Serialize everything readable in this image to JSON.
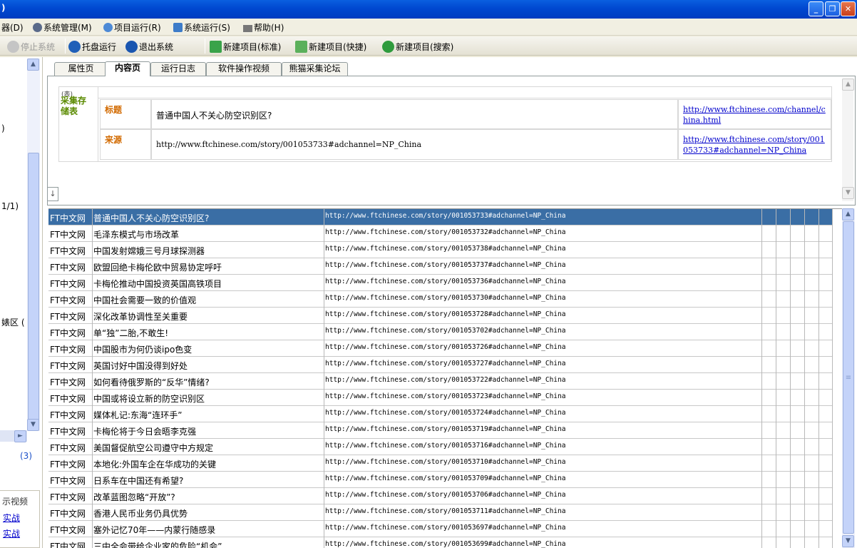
{
  "window": {
    "title": ")",
    "btn_min": "_",
    "btn_max": "❐",
    "btn_close": "✕"
  },
  "menu": [
    {
      "label": "器(D)"
    },
    {
      "label": "系统管理(M)"
    },
    {
      "label": "项目运行(R)"
    },
    {
      "label": "系统运行(S)"
    },
    {
      "label": "帮助(H)"
    }
  ],
  "toolbar": [
    {
      "label": "停止系统"
    },
    {
      "label": "托盘运行"
    },
    {
      "label": "退出系统"
    },
    {
      "label": "新建项目(标准)"
    },
    {
      "label": "新建项目(快捷)"
    },
    {
      "label": "新建项目(搜索)"
    }
  ],
  "leftpane": {
    "t1": ")",
    "t2": "1/1)",
    "t3": "婊区 (",
    "t4": "(3)",
    "t5": "示视频",
    "link1": "实战",
    "link2": "实战"
  },
  "tabs": [
    {
      "label": "属性页"
    },
    {
      "label": "内容页"
    },
    {
      "label": "运行日志"
    },
    {
      "label": "软件操作视频"
    },
    {
      "label": "熊猫采集论坛"
    }
  ],
  "storage": {
    "small_label": "(表)",
    "heading": "采集存储表",
    "rows": [
      {
        "field": "标题",
        "value": "普通中国人不关心防空识别区?",
        "source": "http://www.ftchinese.com/channel/china.html"
      },
      {
        "field": "来源",
        "value": "http://www.ftchinese.com/story/001053733#adchannel=NP_China",
        "source": "http://www.ftchinese.com/story/001053733#adchannel=NP_China"
      }
    ],
    "expand_glyph": "↓"
  },
  "scroll_glyphs": {
    "up": "▲",
    "down": "▼",
    "right": "►",
    "grip": "≡"
  },
  "results": [
    {
      "site": "FT中文网",
      "title": "普通中国人不关心防空识别区?",
      "url": "http://www.ftchinese.com/story/001053733#adchannel=NP_China"
    },
    {
      "site": "FT中文网",
      "title": "毛泽东模式与市场改革",
      "url": "http://www.ftchinese.com/story/001053732#adchannel=NP_China"
    },
    {
      "site": "FT中文网",
      "title": "中国发射嫦娥三号月球探测器",
      "url": "http://www.ftchinese.com/story/001053738#adchannel=NP_China"
    },
    {
      "site": "FT中文网",
      "title": "欧盟回绝卡梅伦欧中贸易协定呼吁",
      "url": "http://www.ftchinese.com/story/001053737#adchannel=NP_China"
    },
    {
      "site": "FT中文网",
      "title": "卡梅伦推动中国投资英国高铁项目",
      "url": "http://www.ftchinese.com/story/001053736#adchannel=NP_China"
    },
    {
      "site": "FT中文网",
      "title": "中国社会需要一致的价值观",
      "url": "http://www.ftchinese.com/story/001053730#adchannel=NP_China"
    },
    {
      "site": "FT中文网",
      "title": "深化改革协调性至关重要",
      "url": "http://www.ftchinese.com/story/001053728#adchannel=NP_China"
    },
    {
      "site": "FT中文网",
      "title": "单“独”二胎,不敢生!",
      "url": "http://www.ftchinese.com/story/001053702#adchannel=NP_China"
    },
    {
      "site": "FT中文网",
      "title": "中国股市为何仍谈ipo色变",
      "url": "http://www.ftchinese.com/story/001053726#adchannel=NP_China"
    },
    {
      "site": "FT中文网",
      "title": "英国讨好中国没得到好处",
      "url": "http://www.ftchinese.com/story/001053727#adchannel=NP_China"
    },
    {
      "site": "FT中文网",
      "title": "如何看待俄罗斯的“反华”情绪?",
      "url": "http://www.ftchinese.com/story/001053722#adchannel=NP_China"
    },
    {
      "site": "FT中文网",
      "title": "中国或将设立新的防空识别区",
      "url": "http://www.ftchinese.com/story/001053723#adchannel=NP_China"
    },
    {
      "site": "FT中文网",
      "title": "媒体札记:东海“连环手”",
      "url": "http://www.ftchinese.com/story/001053724#adchannel=NP_China"
    },
    {
      "site": "FT中文网",
      "title": "卡梅伦将于今日会晤李克强",
      "url": "http://www.ftchinese.com/story/001053719#adchannel=NP_China"
    },
    {
      "site": "FT中文网",
      "title": "美国督促航空公司遵守中方规定",
      "url": "http://www.ftchinese.com/story/001053716#adchannel=NP_China"
    },
    {
      "site": "FT中文网",
      "title": "本地化:外国车企在华成功的关键",
      "url": "http://www.ftchinese.com/story/001053710#adchannel=NP_China"
    },
    {
      "site": "FT中文网",
      "title": "日系车在中国还有希望?",
      "url": "http://www.ftchinese.com/story/001053709#adchannel=NP_China"
    },
    {
      "site": "FT中文网",
      "title": "改革蓝图忽略“开放”?",
      "url": "http://www.ftchinese.com/story/001053706#adchannel=NP_China"
    },
    {
      "site": "FT中文网",
      "title": "香港人民币业务仍具优势",
      "url": "http://www.ftchinese.com/story/001053711#adchannel=NP_China"
    },
    {
      "site": "FT中文网",
      "title": "塞外记忆70年——内蒙行随感录",
      "url": "http://www.ftchinese.com/story/001053697#adchannel=NP_China"
    },
    {
      "site": "FT中文网",
      "title": "三中全会带给企业家的危险“机会”",
      "url": "http://www.ftchinese.com/story/001053699#adchannel=NP_China"
    }
  ]
}
